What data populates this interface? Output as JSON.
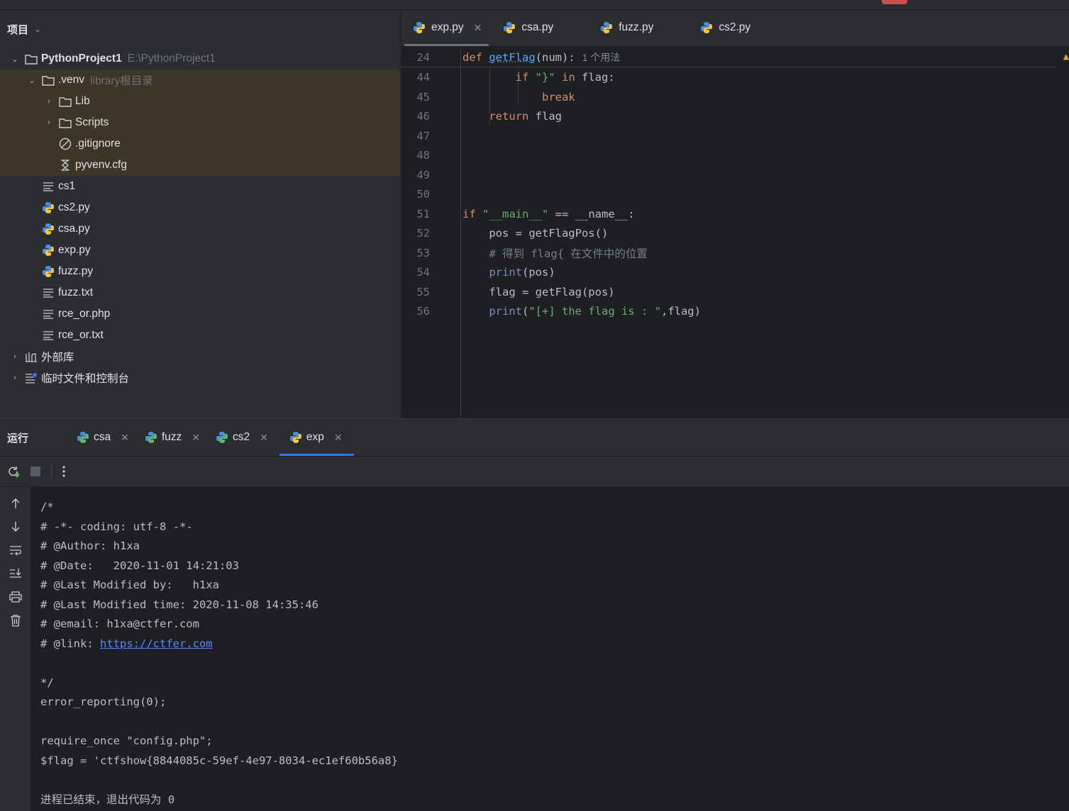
{
  "project_panel": {
    "title": "项目",
    "tree": [
      {
        "label": "PythonProject1",
        "hint": "E:\\PythonProject1",
        "type": "folder",
        "expanded": true
      },
      {
        "label": ".venv",
        "hint": "library根目录",
        "type": "folder",
        "expanded": true
      },
      {
        "label": "Lib",
        "type": "folder",
        "expanded": false
      },
      {
        "label": "Scripts",
        "type": "folder",
        "expanded": false
      },
      {
        "label": ".gitignore",
        "type": "ignore-file"
      },
      {
        "label": "pyvenv.cfg",
        "type": "config-file"
      },
      {
        "label": "cs1",
        "type": "text-file"
      },
      {
        "label": "cs2.py",
        "type": "python-file"
      },
      {
        "label": "csa.py",
        "type": "python-file"
      },
      {
        "label": "exp.py",
        "type": "python-file"
      },
      {
        "label": "fuzz.py",
        "type": "python-file"
      },
      {
        "label": "fuzz.txt",
        "type": "text-file"
      },
      {
        "label": "rce_or.php",
        "type": "text-file"
      },
      {
        "label": "rce_or.txt",
        "type": "text-file"
      },
      {
        "label": "外部库",
        "type": "library"
      },
      {
        "label": "临时文件和控制台",
        "type": "scratches"
      }
    ]
  },
  "editor": {
    "tabs": [
      {
        "label": "exp.py",
        "active": true
      },
      {
        "label": "csa.py"
      },
      {
        "label": "fuzz.py"
      },
      {
        "label": "cs2.py"
      }
    ],
    "sticky": {
      "line": "24",
      "usages": "1 个用法"
    },
    "lines": [
      "44",
      "45",
      "46",
      "47",
      "48",
      "49",
      "50",
      "51",
      "52",
      "53",
      "54",
      "55",
      "56"
    ],
    "comment_53": "# 得到 flag{ 在文件中的位置",
    "print_str": "\"[+] the flag is : \""
  },
  "run_panel": {
    "title": "运行",
    "tabs": [
      {
        "label": "csa"
      },
      {
        "label": "fuzz"
      },
      {
        "label": "cs2"
      },
      {
        "label": "exp",
        "active": true
      }
    ],
    "output": [
      "/*",
      "# -*- coding: utf-8 -*-",
      "# @Author: h1xa",
      "# @Date:   2020-11-01 14:21:03",
      "# @Last Modified by:   h1xa",
      "# @Last Modified time: 2020-11-08 14:35:46",
      "# @email: h1xa@ctfer.com",
      "# @link: ",
      "",
      "*/",
      "error_reporting(0);",
      "",
      "require_once \"config.php\";",
      "$flag = 'ctfshow{8844085c-59ef-4e97-8034-ec1ef60b56a8}",
      "",
      "进程已结束，退出代码为 0"
    ],
    "link": "https://ctfer.com"
  },
  "colors": {
    "accent": "#3574f0",
    "keyword": "#cf8e6d",
    "string": "#6aab73",
    "function": "#56a8f5"
  }
}
